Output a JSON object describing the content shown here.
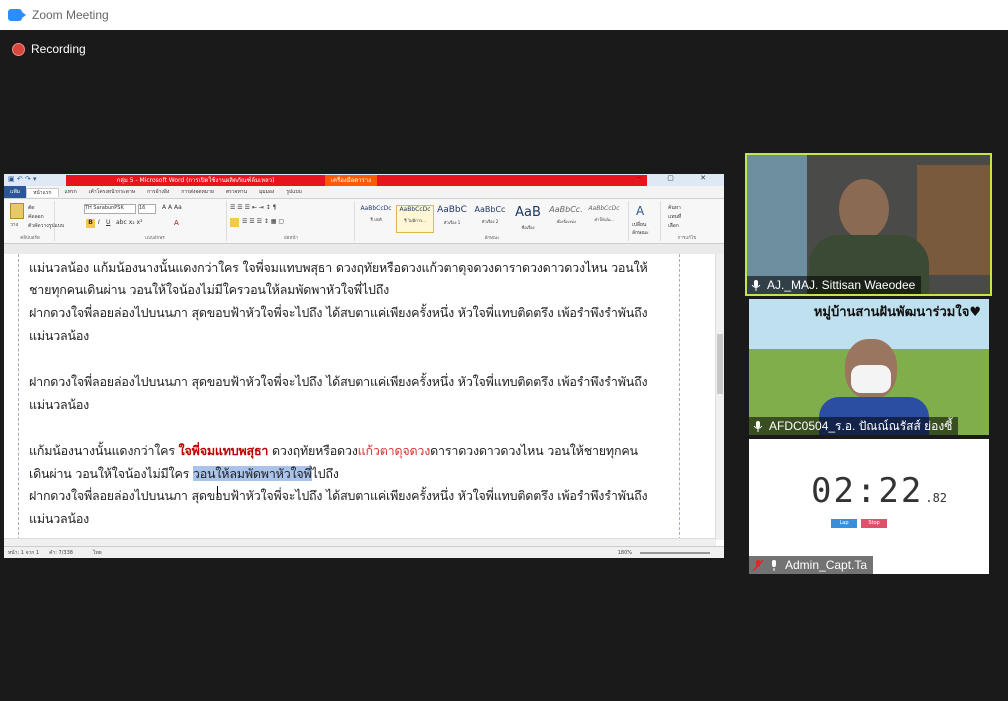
{
  "app": {
    "title": "Zoom Meeting",
    "recording_label": "Recording"
  },
  "word": {
    "title_red": "กลุ่ม 5 - Microsoft Word (การเปิดใช้งานผลิตภัณฑ์ล้มเหลว)",
    "title_orange": "เครื่องมือตาราง",
    "window_buttons": "─ ▢ ✕",
    "tabs": [
      "แฟ้ม",
      "หน้าแรก",
      "แทรก",
      "เค้าโครงหน้ากระดาษ",
      "การอ้างอิง",
      "การส่งจดหมาย",
      "ตรวจทาน",
      "มุมมอง",
      "รูปแบบ"
    ],
    "ribbon": {
      "clipboard": "คลิปบอร์ด",
      "paste": "วาง",
      "cut": "ตัด",
      "copy": "คัดลอก",
      "format_painter": "ตัวคัดวางรูปแบบ",
      "font_group": "แบบอักษร",
      "font_name": "TH SarabunPSK",
      "font_size": "16",
      "paragraph_group": "ย่อหน้า",
      "styles_group": "ลักษณะ",
      "editing_group": "การแก้ไข",
      "find": "ค้นหา",
      "replace": "แทนที่",
      "select": "เลือก",
      "change_styles": "เปลี่ยนลักษณะ"
    },
    "styles": [
      {
        "preview": "AaBbCcDc",
        "name": "¶ ปกติ"
      },
      {
        "preview": "AaBbCcDc",
        "name": "¶ ไม่มีการ..."
      },
      {
        "preview": "AaBbC",
        "name": "หัวเรื่อง 1"
      },
      {
        "preview": "AaBbCc",
        "name": "หัวเรื่อง 2"
      },
      {
        "preview": "AaB",
        "name": "ชื่อเรื่อง"
      },
      {
        "preview": "AaBbCc.",
        "name": "ชื่อเรื่องรอง"
      },
      {
        "preview": "AaBbCcDc",
        "name": "ทำให้เน้น..."
      }
    ],
    "doc_lines": {
      "l1": "แม่นวลน้อง แก้มน้องนางนั้นแดงกว่าใคร ใจพี่จมแทบพสุธา ดวงฤทัยหรือดวงแก้วตาดุจดวงดาราดวงดาวดวงไหน วอนให้",
      "l2": "ชายทุกคนเดินผ่าน วอนให้ใจน้องไม่มีใครวอนให้ลมพัดพาหัวใจพี่ไปถึง",
      "l3": "ฝากดวงใจพี่ลอยล่องไปบนนภา สุดขอบฟ้าหัวใจพี่จะไปถึง ได้สบตาแค่เพียงครั้งหนึ่ง หัวใจพี่แทบติดตรึง เพ้อรำพึงรำพันถึง",
      "l4": "แม่นวลน้อง",
      "l5": "ฝากดวงใจพี่ลอยล่องไปบนนภา สุดขอบฟ้าหัวใจพี่จะไปถึง ได้สบตาแค่เพียงครั้งหนึ่ง หัวใจพี่แทบติดตรึง เพ้อรำพึงรำพันถึง",
      "l6": "แม่นวลน้อง",
      "l7a": "แก้มน้องนางนั้นแดงกว่าใคร ",
      "l7b": "ใจพี่จมแทบพสุธา",
      "l7c": " ดวงฤทัยหรือดวง",
      "l7d": "แก้วตาดุจดวง",
      "l7e": "ดาราดวงดาวดวงไหน วอนให้ชายทุกคน",
      "l8a": "เดินผ่าน วอนให้ใจน้องไม่มีใคร ",
      "l8b": "วอนให้ลมพัดพาหัวใจพี่",
      "l8c": "ไปถึง",
      "l9": "ฝากดวงใจพี่ลอยล่องไปบนนภา สุดขอบฟ้าหัวใจพี่จะไปถึง ได้สบตาแค่เพียงครั้งหนึ่ง หัวใจพี่แทบติดตรึง เพ้อรำพึงรำพันถึง",
      "l10": "แม่นวลน้อง"
    },
    "status": {
      "page": "หน้า: 1 จาก 1",
      "words": "คำ: 7/338",
      "lang": "ไทย",
      "zoom": "180%"
    }
  },
  "participants": [
    {
      "name": "AJ._MAJ. Sittisan  Waeodee",
      "muted": false,
      "active_speaker": true
    },
    {
      "name": "AFDC0504_ร.อ. ปัณณ์ณรัสส์  ย่องซี้",
      "muted": false,
      "banner": "หมู่บ้านสานฝันพัฒนาร่วมใจ♥"
    },
    {
      "name": "Admin_Capt.Ta",
      "muted": true,
      "timer": {
        "main": "02:22",
        "small": ".82",
        "btn1": "Lap",
        "btn2": "Stop"
      }
    }
  ],
  "colors": {
    "active_border": "#c6e44c",
    "recording": "#d9463b",
    "word_red": "#e8141c",
    "word_orange": "#ff5a00"
  }
}
